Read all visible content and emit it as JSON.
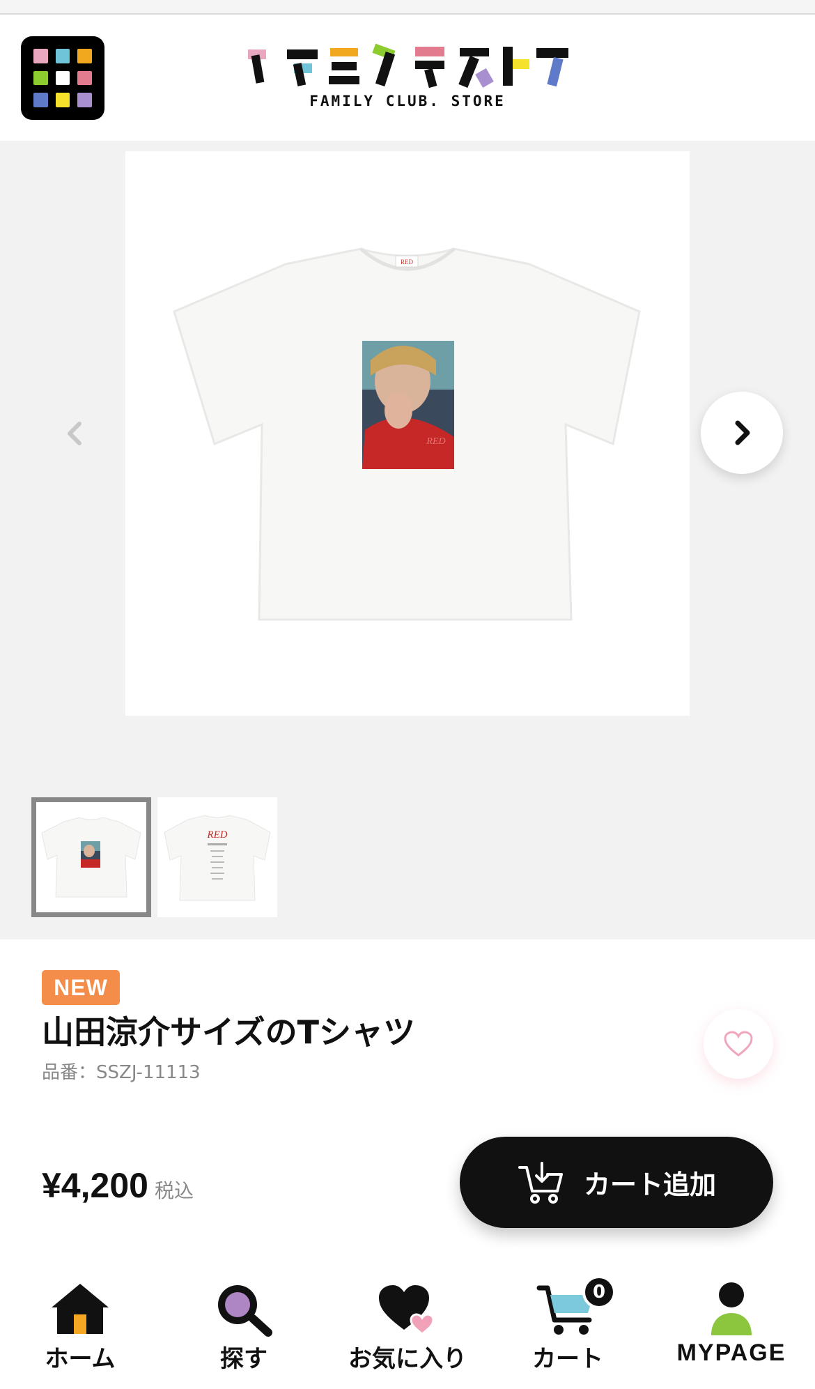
{
  "header": {
    "logo_text": "ファミクラストア",
    "logo_subtitle": "FAMILY CLUB. STORE",
    "menu_colors": [
      "#e8a6bf",
      "#6fc4d8",
      "#f2a81e",
      "#8ccc2e",
      "#ffffff",
      "#e27b8e",
      "#5e7ac8",
      "#f6e22a",
      "#a88fcf"
    ]
  },
  "gallery": {
    "main_image": "t-shirt-front-photo",
    "thumbnails": [
      {
        "name": "t-shirt-front-thumbnail",
        "selected": true
      },
      {
        "name": "t-shirt-back-thumbnail",
        "selected": false
      }
    ],
    "shirt_print_text": "RED"
  },
  "product": {
    "badge": "NEW",
    "title": "山田涼介サイズのTシャツ",
    "sku": "品番：SSZJ-11113",
    "price": "¥4,200",
    "tax_label": "税込",
    "add_to_cart_label": "カート追加"
  },
  "nav": {
    "home": "ホーム",
    "search": "探す",
    "favorites": "お気に入り",
    "cart": "カート",
    "cart_count": "0",
    "mypage": "MYPAGE"
  },
  "colors": {
    "accent_badge": "#f58d4a",
    "button_dark": "#111111",
    "gallery_bg": "#f2f2f2",
    "heart_pink": "#f2a2b8",
    "search_purple": "#ae86c4",
    "home_orange": "#f5a623",
    "cart_blue": "#7cc9dc",
    "mypage_green": "#8cc63f"
  }
}
